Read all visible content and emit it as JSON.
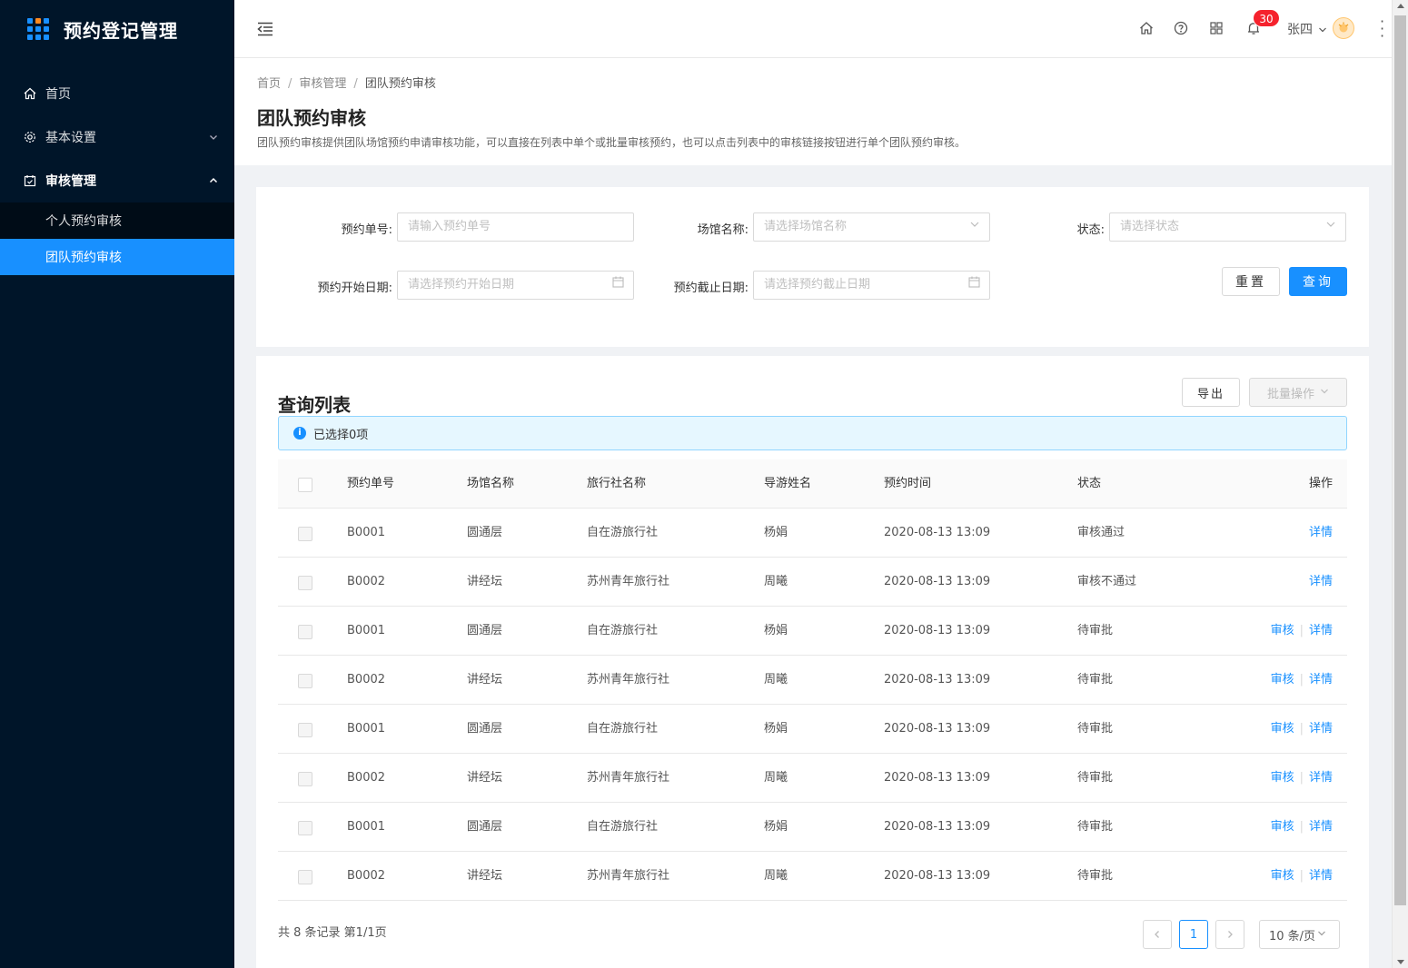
{
  "app": {
    "title": "预约登记管理"
  },
  "sidebar": {
    "items": [
      {
        "label": "首页",
        "icon": "home-icon"
      },
      {
        "label": "基本设置",
        "icon": "gear-icon"
      },
      {
        "label": "审核管理",
        "icon": "calendar-check-icon"
      }
    ],
    "sub_items": [
      {
        "label": "个人预约审核"
      },
      {
        "label": "团队预约审核",
        "active": true
      }
    ]
  },
  "header": {
    "notification_count": "30",
    "user_name": "张四"
  },
  "breadcrumb": [
    "首页",
    "审核管理",
    "团队预约审核"
  ],
  "page": {
    "title": "团队预约审核",
    "description": "团队预约审核提供团队场馆预约申请审核功能，可以直接在列表中单个或批量审核预约，也可以点击列表中的审核链接按钮进行单个团队预约审核。"
  },
  "filter": {
    "order_no_label": "预约单号:",
    "order_no_placeholder": "请输入预约单号",
    "venue_label": "场馆名称:",
    "venue_placeholder": "请选择场馆名称",
    "status_label": "状态:",
    "status_placeholder": "请选择状态",
    "start_label": "预约开始日期:",
    "start_placeholder": "请选择预约开始日期",
    "end_label": "预约截止日期:",
    "end_placeholder": "请选择预约截止日期",
    "reset_label": "重置",
    "query_label": "查询"
  },
  "list": {
    "title": "查询列表",
    "export_label": "导出",
    "batch_label": "批量操作",
    "selected_text": "已选择0项",
    "columns": [
      "预约单号",
      "场馆名称",
      "旅行社名称",
      "导游姓名",
      "预约时间",
      "状态",
      "操作"
    ],
    "rows": [
      {
        "no": "B0001",
        "venue": "圆通层",
        "agency": "自在游旅行社",
        "guide": "杨娟",
        "time": "2020-08-13 13:09",
        "status": "审核通过",
        "review": "",
        "detail": "详情"
      },
      {
        "no": "B0002",
        "venue": "讲经坛",
        "agency": "苏州青年旅行社",
        "guide": "周曦",
        "time": "2020-08-13 13:09",
        "status": "审核不通过",
        "review": "",
        "detail": "详情"
      },
      {
        "no": "B0001",
        "venue": "圆通层",
        "agency": "自在游旅行社",
        "guide": "杨娟",
        "time": "2020-08-13 13:09",
        "status": "待审批",
        "review": "审核",
        "detail": "详情"
      },
      {
        "no": "B0002",
        "venue": "讲经坛",
        "agency": "苏州青年旅行社",
        "guide": "周曦",
        "time": "2020-08-13 13:09",
        "status": "待审批",
        "review": "审核",
        "detail": "详情"
      },
      {
        "no": "B0001",
        "venue": "圆通层",
        "agency": "自在游旅行社",
        "guide": "杨娟",
        "time": "2020-08-13 13:09",
        "status": "待审批",
        "review": "审核",
        "detail": "详情"
      },
      {
        "no": "B0002",
        "venue": "讲经坛",
        "agency": "苏州青年旅行社",
        "guide": "周曦",
        "time": "2020-08-13 13:09",
        "status": "待审批",
        "review": "审核",
        "detail": "详情"
      },
      {
        "no": "B0001",
        "venue": "圆通层",
        "agency": "自在游旅行社",
        "guide": "杨娟",
        "time": "2020-08-13 13:09",
        "status": "待审批",
        "review": "审核",
        "detail": "详情"
      },
      {
        "no": "B0002",
        "venue": "讲经坛",
        "agency": "苏州青年旅行社",
        "guide": "周曦",
        "time": "2020-08-13 13:09",
        "status": "待审批",
        "review": "审核",
        "detail": "详情"
      }
    ],
    "total_text": "共 8 条记录 第1/1页",
    "current_page": "1",
    "page_size": "10 条/页"
  },
  "colors": {
    "primary": "#1890ff",
    "sidebar": "#001529",
    "badge": "#f5222d"
  }
}
